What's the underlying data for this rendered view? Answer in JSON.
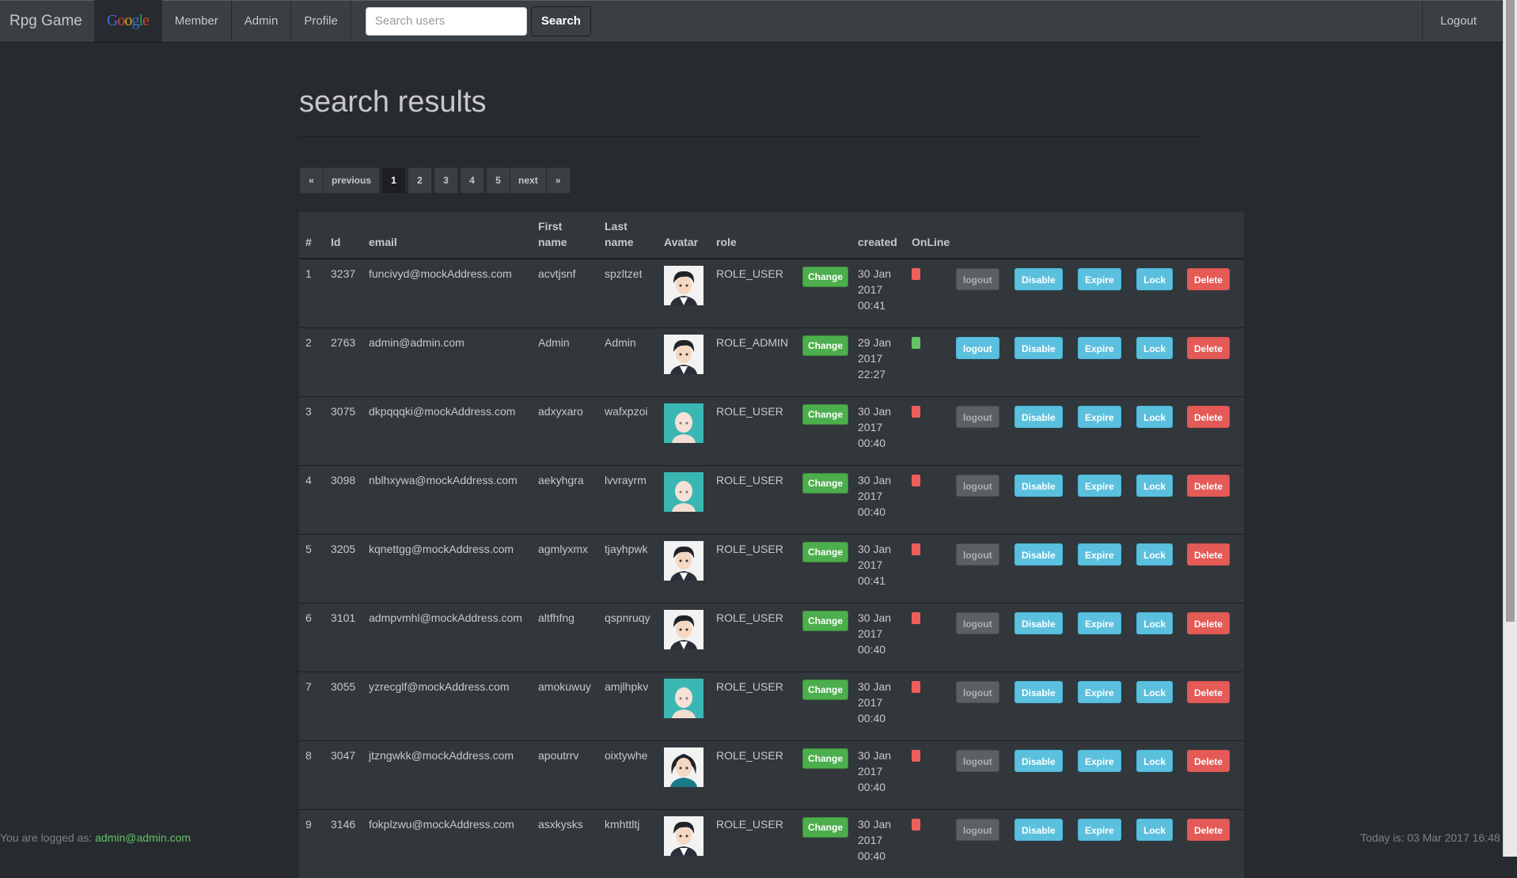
{
  "navbar": {
    "brand": "Rpg Game",
    "google_logo": [
      "G",
      "o",
      "o",
      "g",
      "l",
      "e"
    ],
    "items": [
      "Member",
      "Admin",
      "Profile"
    ],
    "search_placeholder": "Search users",
    "search_button": "Search",
    "logout": "Logout"
  },
  "page": {
    "title": "search results"
  },
  "pagination": {
    "first": "«",
    "previous": "previous",
    "pages": [
      "1",
      "2",
      "3",
      "4",
      "5"
    ],
    "current": "1",
    "next": "next",
    "last": "»"
  },
  "table": {
    "headers": [
      "#",
      "Id",
      "email",
      "First name",
      "Last name",
      "Avatar",
      "role",
      "",
      "created",
      "OnLine"
    ],
    "change_label": "Change",
    "action_labels": {
      "logout": "logout",
      "disable": "Disable",
      "expire": "Expire",
      "lock": "Lock",
      "delete": "Delete"
    },
    "rows": [
      {
        "n": "1",
        "id": "3237",
        "email": "funcivyd@mockAddress.com",
        "first": "acvtjsnf",
        "last": "spzltzet",
        "avatar": "male-dark-hair-avatar",
        "role": "ROLE_USER",
        "created": [
          "30 Jan",
          "2017",
          "00:41"
        ],
        "online": false
      },
      {
        "n": "2",
        "id": "2763",
        "email": "admin@admin.com",
        "first": "Admin",
        "last": "Admin",
        "avatar": "male-dark-hair-avatar",
        "role": "ROLE_ADMIN",
        "created": [
          "29 Jan",
          "2017",
          "22:27"
        ],
        "online": true
      },
      {
        "n": "3",
        "id": "3075",
        "email": "dkpqqqki@mockAddress.com",
        "first": "adxyxaro",
        "last": "wafxpzoi",
        "avatar": "bald-teal-avatar",
        "role": "ROLE_USER",
        "created": [
          "30 Jan",
          "2017",
          "00:40"
        ],
        "online": false
      },
      {
        "n": "4",
        "id": "3098",
        "email": "nblhxywa@mockAddress.com",
        "first": "aekyhgra",
        "last": "lvvrayrm",
        "avatar": "bald-teal-avatar",
        "role": "ROLE_USER",
        "created": [
          "30 Jan",
          "2017",
          "00:40"
        ],
        "online": false
      },
      {
        "n": "5",
        "id": "3205",
        "email": "kqnettgg@mockAddress.com",
        "first": "agmlyxmx",
        "last": "tjayhpwk",
        "avatar": "male-dark-hair-avatar",
        "role": "ROLE_USER",
        "created": [
          "30 Jan",
          "2017",
          "00:41"
        ],
        "online": false
      },
      {
        "n": "6",
        "id": "3101",
        "email": "admpvmhl@mockAddress.com",
        "first": "altfhfng",
        "last": "qspnruqy",
        "avatar": "male-dark-hair-avatar",
        "role": "ROLE_USER",
        "created": [
          "30 Jan",
          "2017",
          "00:40"
        ],
        "online": false
      },
      {
        "n": "7",
        "id": "3055",
        "email": "yzrecglf@mockAddress.com",
        "first": "amokuwuy",
        "last": "amjlhpkv",
        "avatar": "bald-teal-avatar",
        "role": "ROLE_USER",
        "created": [
          "30 Jan",
          "2017",
          "00:40"
        ],
        "online": false
      },
      {
        "n": "8",
        "id": "3047",
        "email": "jtzngwkk@mockAddress.com",
        "first": "apoutrrv",
        "last": "oixtywhe",
        "avatar": "female-dark-hair-avatar",
        "role": "ROLE_USER",
        "created": [
          "30 Jan",
          "2017",
          "00:40"
        ],
        "online": false
      },
      {
        "n": "9",
        "id": "3146",
        "email": "fokplzwu@mockAddress.com",
        "first": "asxkysks",
        "last": "kmhttltj",
        "avatar": "male-dark-hair-avatar",
        "role": "ROLE_USER",
        "created": [
          "30 Jan",
          "2017",
          "00:40"
        ],
        "online": false
      }
    ]
  },
  "footer": {
    "logged_prefix": "You are logged as:",
    "logged_user": "admin@admin.com",
    "today": "Today is: 03 Mar 2017 16:48"
  },
  "colors": {
    "background": "#272b30",
    "navbar": "#3a3f44",
    "online": "#62c462",
    "offline": "#ee5f5b",
    "info": "#5bc0de",
    "danger": "#e35a57",
    "success": "#4cae4c"
  }
}
